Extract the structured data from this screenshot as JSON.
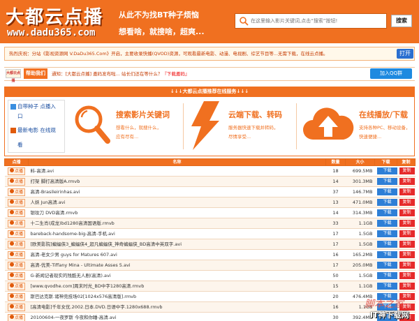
{
  "header": {
    "logo_cn": "大都云点播",
    "logo_en": "www.dadu365.com",
    "slogan_line1": "从此不为找BT种子烦恼",
    "slogan_line2": "想看啥，就搜啥，超爽...",
    "search_placeholder": "在这里输入影片关键词,点击“搜索”按钮!",
    "search_button": "搜索",
    "brand_color": "#f07020"
  },
  "notice": {
    "text": "热烈庆祝：分站《影视资源网 V.DaDu365.Com》开启，主要收录快播(QVOD)资源，可观看最新电影、动漫、电视剧、综艺节目等...无需下载，在线云点播。",
    "button": "打开"
  },
  "info_bar": {
    "small_logo": "大都云点播",
    "help_button": "帮助我们",
    "text_prefix": "通知：[大都云点播] 邀码发布啦... 站长们还在等什么？",
    "text_link": "『下载邀码』",
    "qq_button": "加入QQ群"
  },
  "banner": {
    "title": "↓↓↓大都云点播推荐在线服务↓↓↓",
    "side_items": [
      {
        "label_1": "自带种子 点播入",
        "label_2": "口"
      },
      {
        "label_1": "最新电影 在线观",
        "label_2": "看"
      }
    ],
    "features": [
      {
        "title": "搜索影片关键词",
        "desc_1": "想看什么，就搜什么，",
        "desc_2": "应有尽有..."
      },
      {
        "title": "云端下载、转码",
        "desc_1": "服务器快速下载并转码，",
        "desc_2": "尽情享受..."
      },
      {
        "title": "在线播放/下载",
        "desc_1": "支持各种PC、移动设备，",
        "desc_2": "快速便捷..."
      }
    ]
  },
  "table": {
    "headers": [
      "点播",
      "名称",
      "数量",
      "大小",
      "下载",
      "复制"
    ],
    "play_label": "点播",
    "download_label": "下载",
    "copy_label": "复制",
    "rows": [
      {
        "name": "料-高清.avi",
        "count": "18",
        "size": "699.5MB"
      },
      {
        "name": "打架 脚打高清版A.rmvb",
        "count": "14",
        "size": "301.3MB"
      },
      {
        "name": "高清-Brasileirinhas.avi",
        "count": "37",
        "size": "146.7MB"
      },
      {
        "name": "人妖 Jun高清.avi",
        "count": "13",
        "size": "471.0MB"
      },
      {
        "name": "银妆刀 DVD高清.rmvb",
        "count": "14",
        "size": "314.3MB"
      },
      {
        "name": "十二生肖(成龙)bd1280高清国语版.rmvb",
        "count": "33",
        "size": "1.1GB"
      },
      {
        "name": "bareback-handsome-big-高清-手机.avi",
        "count": "17",
        "size": "1.5GB"
      },
      {
        "name": "[欧美影院]蝙蝠侠3_蝙蝠侠4_超凡蝙蝠侠_神奇蝙蝠侠_BD高清中英双字.avi",
        "count": "17",
        "size": "1.5GB"
      },
      {
        "name": "高清-老女少男 guys for Matures 607.avi",
        "count": "16",
        "size": "165.2MB"
      },
      {
        "name": "高清-优美-Tiffany Mina - Ultimate Asses 5.avi",
        "count": "17",
        "size": "205.0MB"
      },
      {
        "name": "G-新闻记者现实的残酷无人剧(高清).avi",
        "count": "50",
        "size": "1.5GB"
      },
      {
        "name": "[www.qvodhe.com]周末时光_BD中字1280高清.rmvb",
        "count": "15",
        "size": "1.1GB"
      },
      {
        "name": "斯巴达克斯.诸神竞技场02[1024x576高清版].rmvb",
        "count": "20",
        "size": "476.4MB"
      },
      {
        "name": "[高清电影]千年女优.2002.日本.DVD.日语中字.1280x688.rmvb",
        "count": "16",
        "size": "1.1GB"
      },
      {
        "name": "20100604-一夜罗斯 今夜和你睡-高清.avi",
        "count": "30",
        "size": "392.4MB"
      }
    ]
  },
  "watermark": {
    "line1": "脚本之家",
    "line2": "IT神下载网"
  }
}
